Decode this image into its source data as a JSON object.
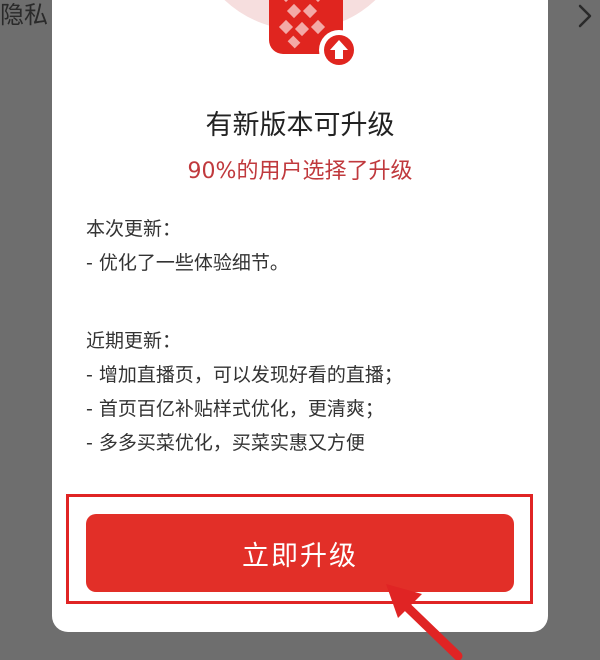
{
  "background": {
    "title": "隐私"
  },
  "dialog": {
    "app_icon": "pinduoduo-app-icon",
    "update_badge_icon": "arrow-up-icon",
    "title": "有新版本可升级",
    "subtitle": "90%的用户选择了升级",
    "current_update": {
      "heading": "本次更新：",
      "items": [
        "- 优化了一些体验细节。"
      ]
    },
    "recent_updates": {
      "heading": "近期更新：",
      "items": [
        "- 增加直播页，可以发现好看的直播；",
        "- 首页百亿补贴样式优化，更清爽；",
        "- 多多买菜优化，买菜实惠又方便"
      ]
    },
    "upgrade_button": "立即升级"
  },
  "colors": {
    "accent": "#e22f28",
    "subtitle": "#c0393d",
    "overlay": "#6e6e6e",
    "annotation": "#e02424"
  }
}
